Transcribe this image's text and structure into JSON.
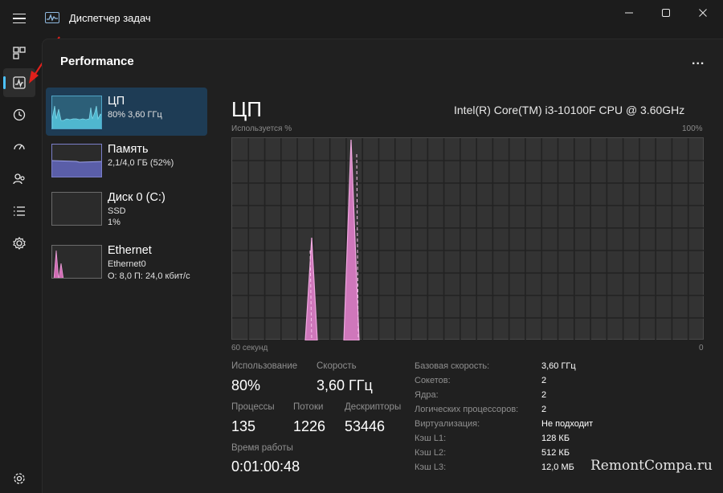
{
  "window": {
    "title": "Диспетчер задач",
    "minimize_icon": "minimize-icon",
    "maximize_icon": "maximize-icon",
    "close_icon": "close-icon"
  },
  "rail": {
    "items": [
      {
        "name": "processes",
        "icon": "processes-icon"
      },
      {
        "name": "performance",
        "icon": "performance-icon",
        "active": true
      },
      {
        "name": "app-history",
        "icon": "history-icon"
      },
      {
        "name": "startup",
        "icon": "startup-icon"
      },
      {
        "name": "users",
        "icon": "users-icon"
      },
      {
        "name": "details",
        "icon": "details-icon"
      },
      {
        "name": "services",
        "icon": "services-icon"
      },
      {
        "name": "settings",
        "icon": "settings-icon"
      }
    ]
  },
  "page": {
    "title": "Performance",
    "more": "..."
  },
  "devices": [
    {
      "name": "ЦП",
      "line1": "80% 3,60 ГГц",
      "line2": "",
      "selected": true
    },
    {
      "name": "Память",
      "line1": "2,1/4,0 ГБ (52%)",
      "line2": ""
    },
    {
      "name": "Диск 0 (C:)",
      "line1": "SSD",
      "line2": "1%"
    },
    {
      "name": "Ethernet",
      "line1": "Ethernet0",
      "line2": "О: 8,0 П: 24,0 кбит/с"
    }
  ],
  "detail": {
    "title": "ЦП",
    "model": "Intel(R) Core(TM) i3-10100F CPU @ 3.60GHz",
    "y_label": "Используется %",
    "y_max": "100%",
    "x_left": "60 секунд",
    "x_right": "0"
  },
  "stats": {
    "usage_label": "Использование",
    "usage_value": "80%",
    "speed_label": "Скорость",
    "speed_value": "3,60 ГГц",
    "processes_label": "Процессы",
    "processes_value": "135",
    "threads_label": "Потоки",
    "threads_value": "1226",
    "handles_label": "Дескрипторы",
    "handles_value": "53446",
    "uptime_label": "Время работы",
    "uptime_value": "0:01:00:48"
  },
  "specs": [
    {
      "label": "Базовая скорость:",
      "value": "3,60 ГГц"
    },
    {
      "label": "Сокетов:",
      "value": "2"
    },
    {
      "label": "Ядра:",
      "value": "2"
    },
    {
      "label": "Логических процессоров:",
      "value": "2"
    },
    {
      "label": "Виртуализация:",
      "value": "Не подходит"
    },
    {
      "label": "Кэш L1:",
      "value": "128 КБ"
    },
    {
      "label": "Кэш L2:",
      "value": "512 КБ"
    },
    {
      "label": "Кэш L3:",
      "value": "12,0 МБ"
    }
  ],
  "watermark": "RemontCompa.ru",
  "colors": {
    "accent": "#4cc2ff",
    "cpu_graph": "#e48bd0",
    "selected_bg": "#1e3c55",
    "arrow": "#e0201b"
  }
}
